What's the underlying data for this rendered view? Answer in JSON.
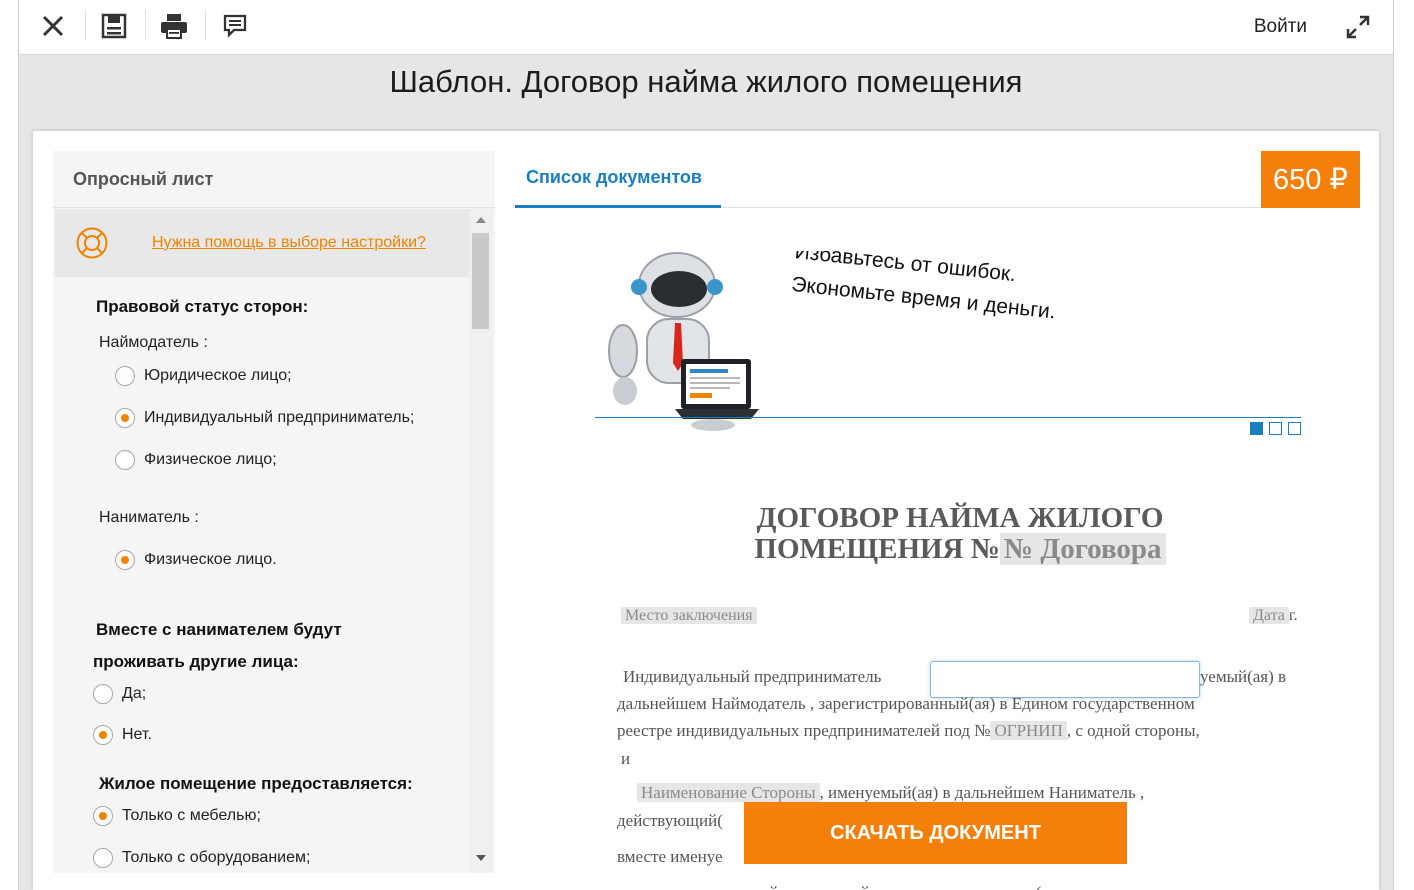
{
  "toolbar": {
    "icons": [
      "close-icon",
      "save-icon",
      "print-icon",
      "comment-icon",
      "expand-icon"
    ],
    "login_label": "Войти"
  },
  "page_title": "Шаблон. Договор найма жилого помещения",
  "sidebar": {
    "heading": "Опросный лист",
    "help_link": "Нужна помощь в выборе настройки?",
    "questions": [
      {
        "title": "Правовой статус сторон:",
        "groups": [
          {
            "label": "Наймодатель :",
            "options": [
              {
                "label": "Юридическое лицо;",
                "selected": false
              },
              {
                "label": "Индивидуальный предприниматель;",
                "selected": true
              },
              {
                "label": "Физическое лицо;",
                "selected": false
              }
            ]
          },
          {
            "label": "Наниматель :",
            "options": [
              {
                "label": "Физическое лицо.",
                "selected": true
              }
            ]
          }
        ]
      },
      {
        "title_line1": "Вместе с нанимателем будут",
        "title_line2": "проживать другие лица:",
        "options": [
          {
            "label": "Да;",
            "selected": false
          },
          {
            "label": "Нет.",
            "selected": true
          }
        ]
      },
      {
        "title": "Жилое помещение  предоставляется:",
        "options": [
          {
            "label": "Только с мебелью;",
            "selected": true
          },
          {
            "label": "Только с оборудованием;",
            "selected": false
          }
        ]
      }
    ]
  },
  "tabs": [
    {
      "label": "Список документов",
      "active": true
    }
  ],
  "price": "650 ₽",
  "banner": {
    "line1": "Избавьтесь от ошибок.",
    "line2": "Экономьте время и деньги.",
    "slides": 3,
    "active_slide": 0
  },
  "document": {
    "title_line1": "ДОГОВОР НАЙМА ЖИЛОГО",
    "title_line2_prefix": "ПОМЕЩЕНИЯ №",
    "contract_number_ph": "№ Договора",
    "place_ph": "Место заключения",
    "date_ph": "Дата",
    "date_suffix": "г.",
    "p1_line1_a": "Индивидуальный предприниматель",
    "p1_line1_b": "уемый(ая) в",
    "p1_line2": "дальнейшем  Наймодатель , зарегистрированный(ая) в Едином государственном",
    "p1_line3_a": "реестре индивидуальных предпринимателей под №",
    "ogrnip_ph": "ОГРНИП",
    "p1_line3_b": ",  с одной стороны,",
    "p1_line4": "и",
    "party_ph": "Наименование  Стороны",
    "p2_line1": ",  именуемый(ая)  в  дальнейшем  Наниматель ,",
    "p2_line2": "действующий(",
    "p3_line1": "вместе именуе",
    "p4_line1": "заключили  настоящий  договор  найма  жилого  помещения  (далее по тексту"
  },
  "download_button": "СКАЧАТЬ ДОКУМЕНТ",
  "colors": {
    "accent": "#f57f0b",
    "link_blue": "#1a7fc0",
    "help_link": "#f08300"
  }
}
